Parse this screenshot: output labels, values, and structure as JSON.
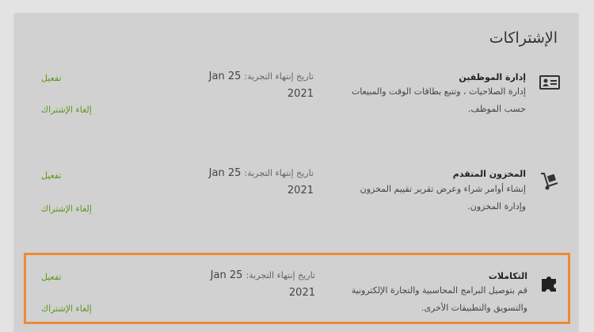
{
  "page": {
    "title": "الإشتراكات"
  },
  "subscriptions": [
    {
      "icon": "id-card-icon",
      "name": "إدارة الموظفين",
      "description": "إدارة الصلاحيات ، وتتبع بطاقات الوقت والمبيعات حسب الموظف.",
      "trial_label": "تاريخ إنتهاء التجربة:",
      "trial_date": "Jan 25",
      "trial_year": "2021",
      "activate_label": "تفعيل",
      "cancel_label": "إلغاء الإشتراك"
    },
    {
      "icon": "hand-truck-icon",
      "name": "المخزون المتقدم",
      "description": "إنشاء أوامر شراء وعرض تقرير تقييم المخزون وإدارة المخزون.",
      "trial_label": "تاريخ إنتهاء التجربة:",
      "trial_date": "Jan 25",
      "trial_year": "2021",
      "activate_label": "تفعيل",
      "cancel_label": "إلغاء الإشتراك"
    },
    {
      "icon": "puzzle-piece-icon",
      "name": "التكاملات",
      "description": "قم بتوصيل البرامج المحاسبية والتجارة الإلكترونية والتسويق والتطبيقات الأخرى.",
      "trial_label": "تاريخ إنتهاء التجربة:",
      "trial_date": "Jan 25",
      "trial_year": "2021",
      "activate_label": "تفعيل",
      "cancel_label": "إلغاء الإشتراك"
    }
  ],
  "colors": {
    "accent_link": "#5a9a1a",
    "highlight_border": "#ee8a36",
    "card_bg": "#d1d1d1"
  }
}
